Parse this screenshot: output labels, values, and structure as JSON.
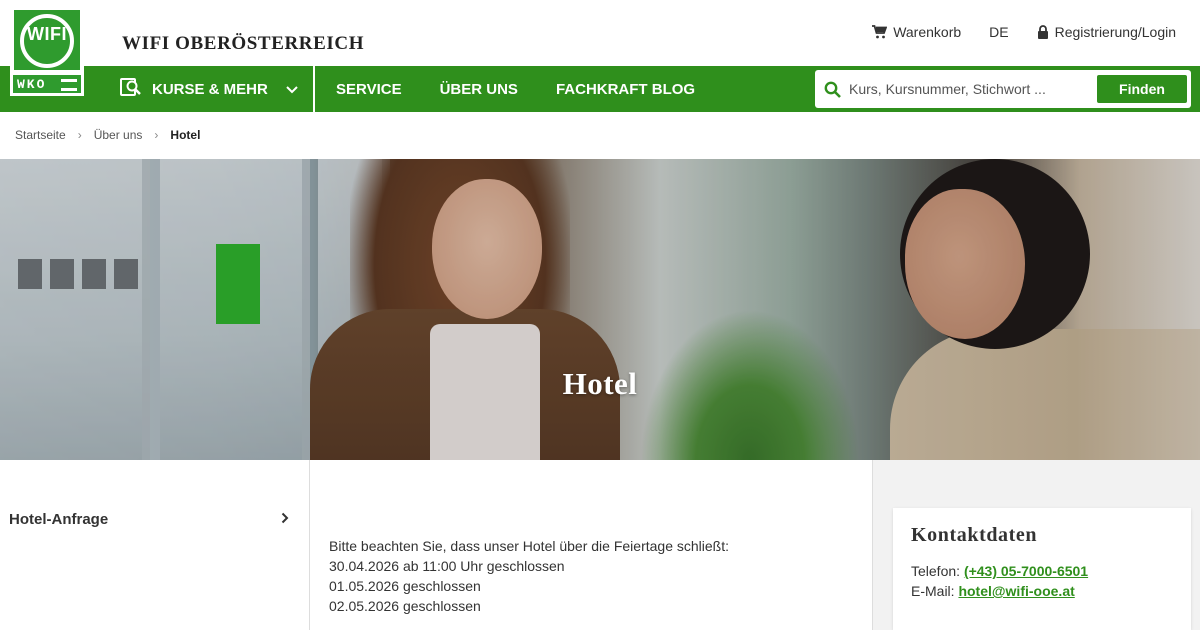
{
  "header": {
    "logo_text": "WIFI",
    "logo_sub": "WKO",
    "site_title": "WIFI OBERÖSTERREICH",
    "cart_label": "Warenkorb",
    "language": "DE",
    "login_label": "Registrierung/Login"
  },
  "nav": {
    "kurse_label": "KURSE & MEHR",
    "items": [
      "SERVICE",
      "ÜBER UNS",
      "FACHKRAFT BLOG"
    ]
  },
  "search": {
    "placeholder": "Kurs, Kursnummer, Stichwort ...",
    "button_label": "Finden"
  },
  "breadcrumb": [
    "Startseite",
    "Über uns",
    "Hotel"
  ],
  "hero": {
    "title": "Hotel"
  },
  "sidebar": {
    "items": [
      {
        "label": "Hotel-Anfrage"
      }
    ]
  },
  "notice": {
    "lines": [
      "Bitte beachten Sie, dass unser Hotel über die Feiertage schließt:",
      "30.04.2026 ab 11:00 Uhr geschlossen",
      "01.05.2026 geschlossen",
      "02.05.2026 geschlossen"
    ]
  },
  "contact": {
    "title": "Kontaktdaten",
    "phone_label": "Telefon:",
    "phone": "(+43) 05-7000-6501",
    "email_label": "E-Mail:",
    "email": "hotel@wifi-ooe.at"
  },
  "colors": {
    "brand_green": "#2f8f1c",
    "logo_green": "#2f9b2e"
  }
}
